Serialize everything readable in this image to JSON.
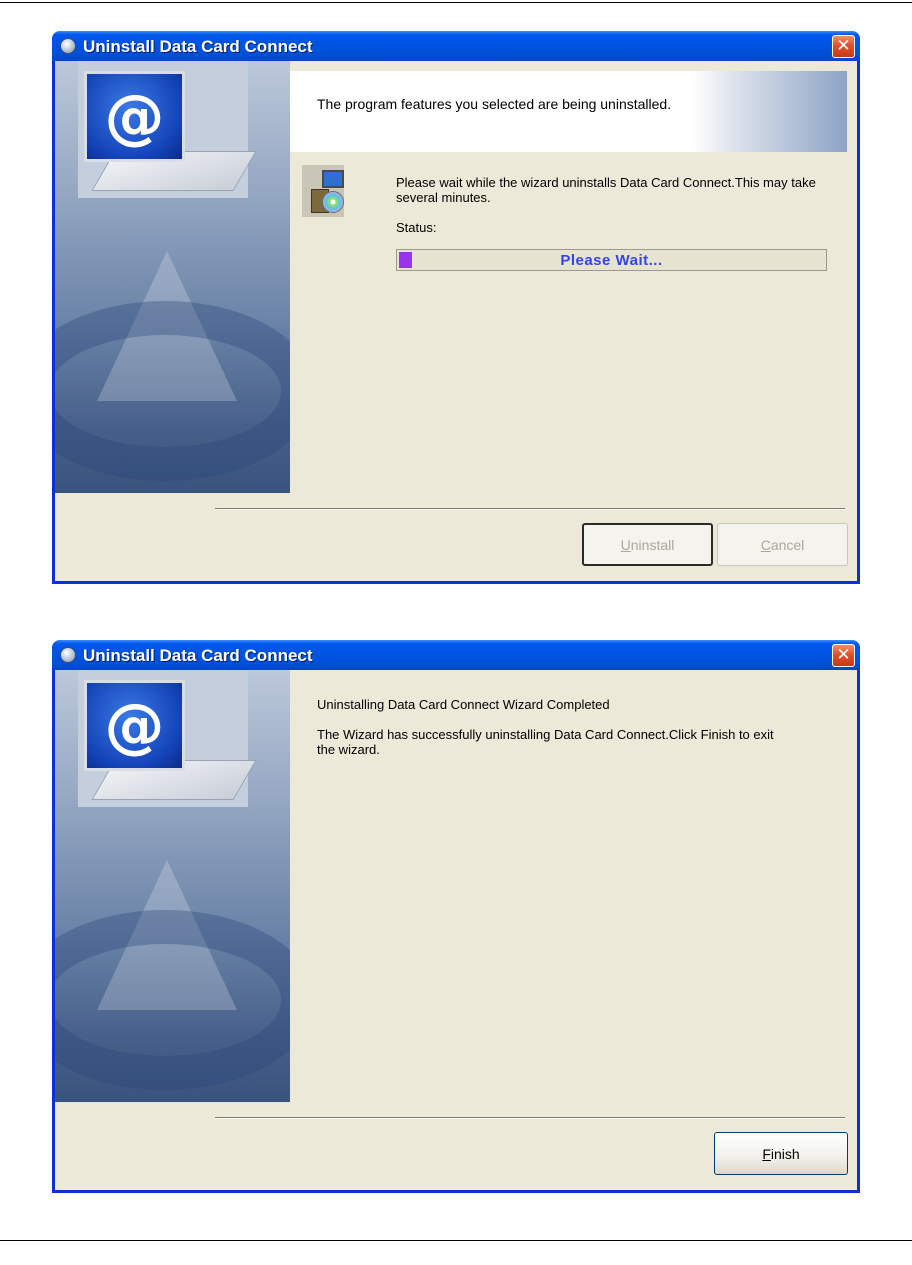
{
  "windows": [
    {
      "title": "Uninstall Data Card Connect",
      "header_text": "The program features you selected are being uninstalled.",
      "message": "Please wait while the wizard uninstalls Data Card Connect.This may take several minutes.",
      "status_label": "Status:",
      "progress_text": "Please Wait...",
      "progress_fraction": 0.03,
      "progress_color": "#9933ee",
      "buttons": {
        "uninstall": {
          "accel": "U",
          "rest": "ninstall"
        },
        "cancel": {
          "accel": "C",
          "rest": "ancel"
        }
      }
    },
    {
      "title": "Uninstall Data Card Connect",
      "heading": "Uninstalling Data Card Connect  Wizard Completed",
      "message": "The Wizard has successfully uninstalling Data Card Connect.Click Finish to exit the wizard.",
      "buttons": {
        "finish": {
          "accel": "F",
          "rest": "inish"
        }
      }
    }
  ],
  "icons": {
    "title": "app-icon",
    "close": "close-icon",
    "logo": "laptop-at-icon",
    "installer": "installer-icon"
  },
  "colors": {
    "titlebar": "#0054e3",
    "client": "#ece9d8",
    "close": "#e0532a"
  }
}
